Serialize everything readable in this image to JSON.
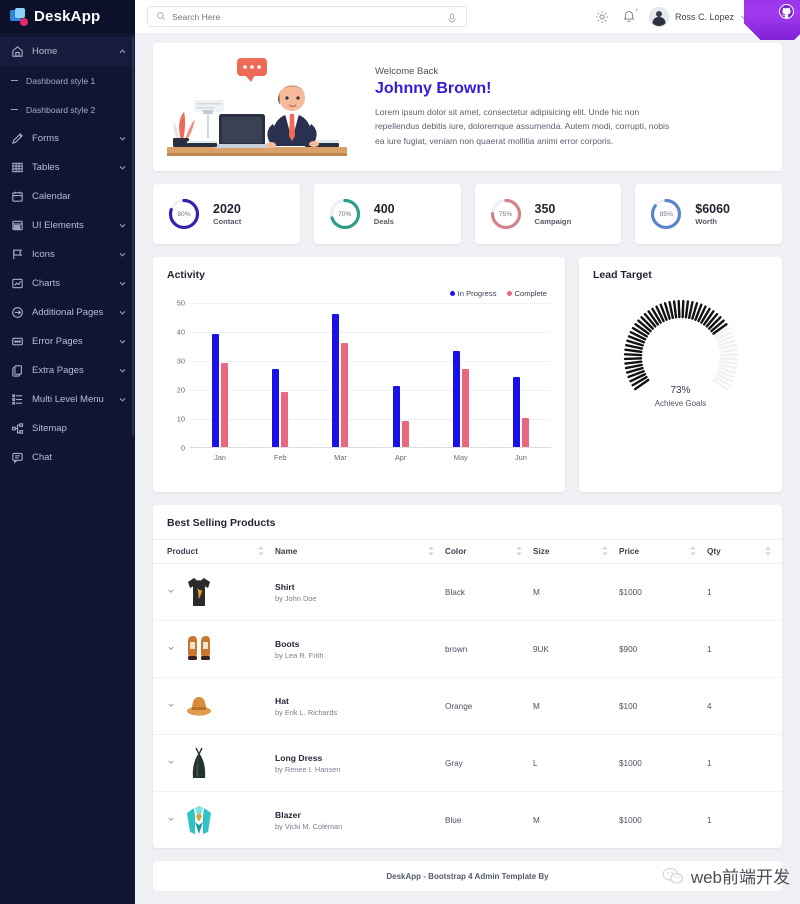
{
  "brand": {
    "name": "DeskApp"
  },
  "search": {
    "placeholder": "Search Here",
    "value": ""
  },
  "header": {
    "user_name": "Ross C. Lopez",
    "settings_icon": "gear-icon",
    "bell_icon": "bell-icon",
    "bell_badge": "*"
  },
  "sidebar": {
    "items": [
      {
        "label": "Home",
        "icon": "home-icon",
        "caret": "chevron-up-icon",
        "active": true
      },
      {
        "label": "Dashboard style 1",
        "icon": "dash-icon",
        "sub": true
      },
      {
        "label": "Dashboard style 2",
        "icon": "dash-icon",
        "sub": true
      },
      {
        "label": "Forms",
        "icon": "pencil-icon",
        "caret": "chevron-down-icon"
      },
      {
        "label": "Tables",
        "icon": "table-icon",
        "caret": "chevron-down-icon"
      },
      {
        "label": "Calendar",
        "icon": "calendar-icon",
        "caret": ""
      },
      {
        "label": "UI Elements",
        "icon": "grid-icon",
        "caret": "chevron-down-icon"
      },
      {
        "label": "Icons",
        "icon": "flag-icon",
        "caret": "chevron-down-icon"
      },
      {
        "label": "Charts",
        "icon": "chart-icon",
        "caret": "chevron-down-icon"
      },
      {
        "label": "Additional Pages",
        "icon": "arrow-right-icon",
        "caret": "chevron-down-icon"
      },
      {
        "label": "Error Pages",
        "icon": "error-icon",
        "caret": "chevron-down-icon"
      },
      {
        "label": "Extra Pages",
        "icon": "copy-icon",
        "caret": "chevron-down-icon"
      },
      {
        "label": "Multi Level Menu",
        "icon": "list-icon",
        "caret": "chevron-down-icon"
      },
      {
        "label": "Sitemap",
        "icon": "sitemap-icon",
        "caret": ""
      },
      {
        "label": "Chat",
        "icon": "chat-icon",
        "caret": ""
      }
    ]
  },
  "welcome": {
    "greeting": "Welcome Back",
    "name": "Johnny Brown!",
    "body": "Lorem ipsum dolor sit amet, consectetur adipisicing elit. Unde hic non repellendus debitis iure, doloremque assumenda. Autem modi, corrupti, nobis ea iure fugiat, veniam non quaerat mollitia animi error corporis.",
    "name_color": "#2f1ddb"
  },
  "stats": [
    {
      "percent": "80%",
      "pct_value": 80,
      "value": "2020",
      "label": "Contact",
      "color": "#3b1fb0"
    },
    {
      "percent": "70%",
      "pct_value": 70,
      "value": "400",
      "label": "Deals",
      "color": "#2f9e86"
    },
    {
      "percent": "75%",
      "pct_value": 75,
      "value": "350",
      "label": "Campaign",
      "color": "#d4838c"
    },
    {
      "percent": "85%",
      "pct_value": 85,
      "value": "$6060",
      "label": "Worth",
      "color": "#5b86c9"
    }
  ],
  "activity": {
    "title": "Activity"
  },
  "lead_target": {
    "title": "Lead Target",
    "value": "73%",
    "value_number": 73,
    "label": "Achieve Goals"
  },
  "products": {
    "title": "Best Selling Products",
    "columns": [
      "Product",
      "Name",
      "Color",
      "Size",
      "Price",
      "Qty"
    ],
    "rows": [
      {
        "name": "Shirt",
        "by": "by John Doe",
        "color": "Black",
        "size": "M",
        "price": "$1000",
        "qty": "1",
        "thumb": "tshirt"
      },
      {
        "name": "Boots",
        "by": "by Lea R. Frith",
        "color": "brown",
        "size": "9UK",
        "price": "$900",
        "qty": "1",
        "thumb": "boots"
      },
      {
        "name": "Hat",
        "by": "by Erik L. Richards",
        "color": "Orange",
        "size": "M",
        "price": "$100",
        "qty": "4",
        "thumb": "hat"
      },
      {
        "name": "Long Dress",
        "by": "by Renee I. Hansen",
        "color": "Gray",
        "size": "L",
        "price": "$1000",
        "qty": "1",
        "thumb": "dress"
      },
      {
        "name": "Blazer",
        "by": "by Vicki M. Coleman",
        "color": "Blue",
        "size": "M",
        "price": "$1000",
        "qty": "1",
        "thumb": "blazer"
      }
    ]
  },
  "footer": {
    "text": "DeskApp - Bootstrap 4 Admin Template By"
  },
  "watermark": {
    "text": "web前端开发"
  },
  "chart_data": {
    "type": "bar",
    "title": "Activity",
    "categories": [
      "Jan",
      "Feb",
      "Mar",
      "Apr",
      "May",
      "Jun"
    ],
    "series": [
      {
        "name": "In Progress",
        "color": "#1a11e8",
        "values": [
          39,
          27,
          46,
          21,
          33,
          24
        ]
      },
      {
        "name": "Complete",
        "color": "#e8697e",
        "values": [
          29,
          19,
          36,
          9,
          27,
          10
        ]
      }
    ],
    "xlabel": "",
    "ylabel": "",
    "ylim": [
      0,
      50
    ],
    "yticks": [
      0,
      10,
      20,
      30,
      40,
      50
    ],
    "grid": true,
    "legend_position": "top-right"
  }
}
